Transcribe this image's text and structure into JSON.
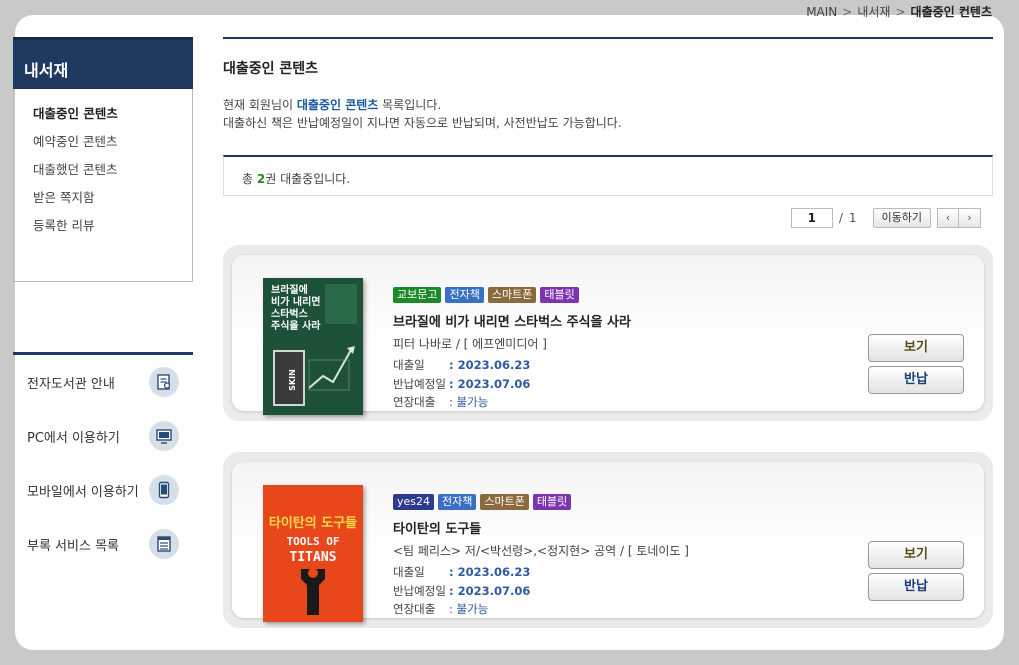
{
  "breadcrumb": {
    "home": "MAIN",
    "section": "내서재",
    "current": "대출중인 컨텐츠",
    "sep": ">"
  },
  "sidebar": {
    "title": "내서재",
    "items": [
      {
        "label": "대출중인 콘텐츠"
      },
      {
        "label": "예약중인 콘텐츠"
      },
      {
        "label": "대출했던 콘텐츠"
      },
      {
        "label": "받은 쪽지함"
      },
      {
        "label": "등록한 리뷰"
      }
    ],
    "links": [
      {
        "label": "전자도서관 안내",
        "icon": "guide-book-icon"
      },
      {
        "label": "PC에서 이용하기",
        "icon": "monitor-icon"
      },
      {
        "label": "모바일에서 이용하기",
        "icon": "mobile-icon"
      },
      {
        "label": "부록 서비스 목록",
        "icon": "list-icon"
      }
    ]
  },
  "main": {
    "title": "대출중인 콘텐츠",
    "desc_prefix": "현재 회원님이 ",
    "desc_highlight": "대출중인 콘텐츠",
    "desc_suffix": " 목록입니다.",
    "desc_line2": "대출하신 책은 반납예정일이 지나면 자동으로 반납되며, 사전반납도 가능합니다.",
    "count_prefix": "총 ",
    "count_num": "2",
    "count_suffix": "권 대출중입니다."
  },
  "pager": {
    "current": "1",
    "sep": "/",
    "total": "1",
    "go_label": "이동하기",
    "prev": "‹",
    "next": "›"
  },
  "books": [
    {
      "badges": [
        {
          "label": "교보문고",
          "color": "#1d8a2a"
        },
        {
          "label": "전자책",
          "color": "#3a6fc6"
        },
        {
          "label": "스마트폰",
          "color": "#8b6b3d"
        },
        {
          "label": "태블릿",
          "color": "#7e34b0"
        }
      ],
      "title": "브라질에 비가 내리면 스타벅스 주식을 사라",
      "author": "피터 나바로 / [ 에프엔미디어 ]",
      "loan_label": "대출일",
      "loan_date": ": 2023.06.23",
      "due_label": "반납예정일",
      "due_date": ": 2023.07.06",
      "ext_label": "연장대출",
      "ext_value": ": 불가능",
      "view_label": "보기",
      "return_label": "반납",
      "cover": {
        "line1": "브라질에",
        "line2": "비가 내리면",
        "line3": "스타벅스",
        "line4": "주식을 사라",
        "word": "SKIN",
        "bg": "#1f5a3a"
      }
    },
    {
      "badges": [
        {
          "label": "yes24",
          "color": "#2e3a8f"
        },
        {
          "label": "전자책",
          "color": "#3a6fc6"
        },
        {
          "label": "스마트폰",
          "color": "#8b6b3d"
        },
        {
          "label": "태블릿",
          "color": "#7e34b0"
        }
      ],
      "title": "타이탄의 도구들",
      "author": "<팀 페리스> 저/<박선령>,<정지현> 공역 / [ 토네이도 ]",
      "loan_label": "대출일",
      "loan_date": ": 2023.06.23",
      "due_label": "반납예정일",
      "due_date": ": 2023.07.06",
      "ext_label": "연장대출",
      "ext_value": ": 불가능",
      "view_label": "보기",
      "return_label": "반납",
      "cover": {
        "title_ko": "타이탄의 도구들",
        "line1": "TOOLS OF",
        "line2": "TITANS",
        "bg": "#e8471c"
      }
    }
  ]
}
